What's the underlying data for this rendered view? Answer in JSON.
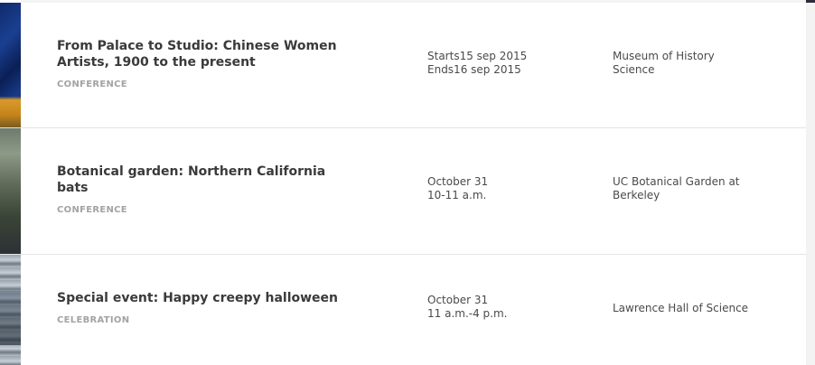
{
  "events": [
    {
      "title_line1": "From Palace to Studio: Chinese Women",
      "title_line2": "Artists, 1900 to the present",
      "category": "CONFERENCE",
      "date_line1": "Starts15 sep 2015",
      "date_line2": "Ends16 sep 2015",
      "location_line1": "Museum of History",
      "location_line2": "Science"
    },
    {
      "title_line1": "Botanical garden: Northern California",
      "title_line2": "bats",
      "category": "CONFERENCE",
      "date_line1": "October 31",
      "date_line2": "10-11 a.m.",
      "location_line1": "UC Botanical Garden at",
      "location_line2": "Berkeley"
    },
    {
      "title_line1": "Special event: Happy creepy halloween",
      "category": "CELEBRATION",
      "date_line1": "October 31",
      "date_line2": "11 a.m.-4 p.m.",
      "location_line1": "Lawrence Hall of Science"
    }
  ]
}
